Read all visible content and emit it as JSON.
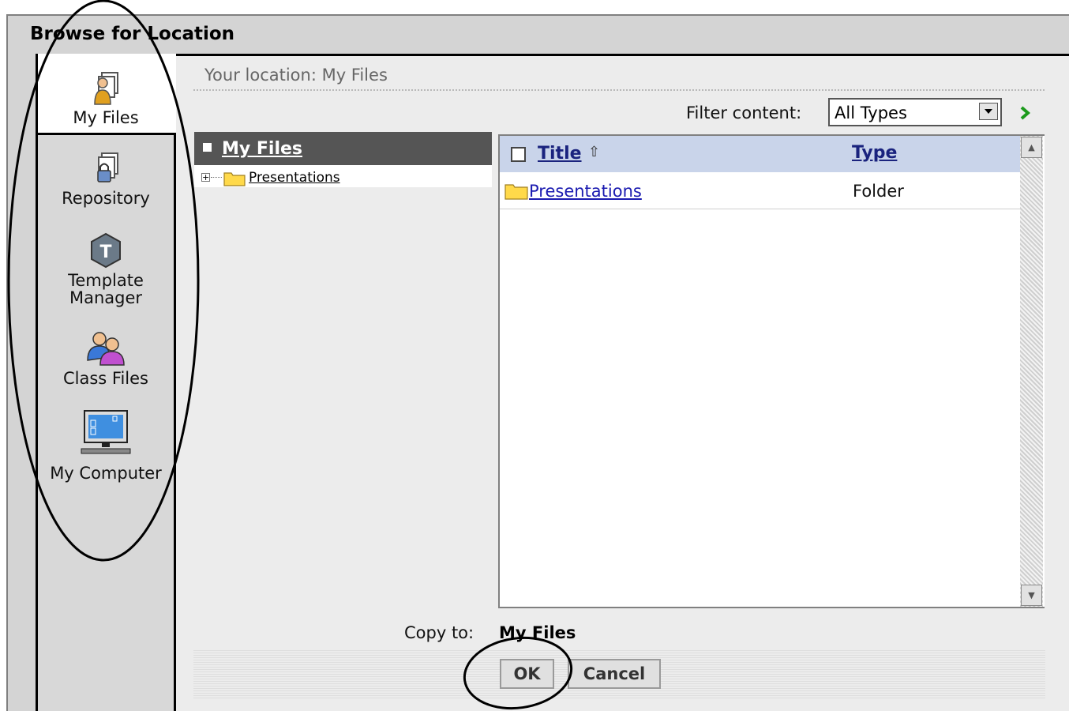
{
  "window": {
    "title": "Browse for Location"
  },
  "sidebar": {
    "items": [
      {
        "label": "My Files",
        "icon": "my-files-icon",
        "active": true
      },
      {
        "label": "Repository",
        "icon": "repository-icon",
        "active": false
      },
      {
        "label": "Template Manager",
        "icon": "template-manager-icon",
        "active": false
      },
      {
        "label": "Class Files",
        "icon": "class-files-icon",
        "active": false
      },
      {
        "label": "My Computer",
        "icon": "my-computer-icon",
        "active": false
      }
    ]
  },
  "location": {
    "text": "Your location: My Files"
  },
  "filter": {
    "label": "Filter content:",
    "selected": "All Types"
  },
  "tree": {
    "root": "My Files",
    "items": [
      {
        "label": "Presentations"
      }
    ]
  },
  "list": {
    "columns": {
      "title": "Title",
      "type": "Type"
    },
    "rows": [
      {
        "name": "Presentations",
        "type": "Folder"
      }
    ]
  },
  "copy": {
    "label": "Copy to:",
    "value": "My Files"
  },
  "buttons": {
    "ok": "OK",
    "cancel": "Cancel"
  },
  "colors": {
    "accent": "#1a237e",
    "link": "#1a1ab0",
    "tree_header": "#555555",
    "list_header": "#c9d4ea"
  }
}
